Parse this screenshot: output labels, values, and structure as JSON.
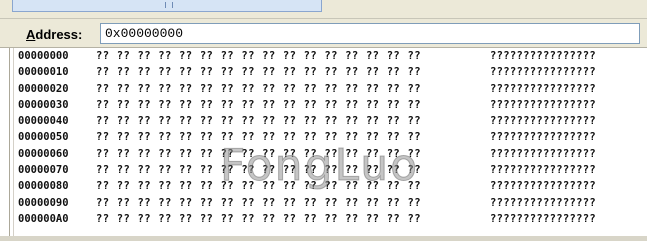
{
  "address_bar": {
    "label_first": "A",
    "label_rest": "ddress:",
    "value": "0x00000000"
  },
  "memory": {
    "rows": [
      {
        "addr": "00000000",
        "bytes": "?? ?? ?? ?? ?? ?? ?? ?? ?? ?? ?? ?? ?? ?? ?? ??",
        "ascii": "????????????????"
      },
      {
        "addr": "00000010",
        "bytes": "?? ?? ?? ?? ?? ?? ?? ?? ?? ?? ?? ?? ?? ?? ?? ??",
        "ascii": "????????????????"
      },
      {
        "addr": "00000020",
        "bytes": "?? ?? ?? ?? ?? ?? ?? ?? ?? ?? ?? ?? ?? ?? ?? ??",
        "ascii": "????????????????"
      },
      {
        "addr": "00000030",
        "bytes": "?? ?? ?? ?? ?? ?? ?? ?? ?? ?? ?? ?? ?? ?? ?? ??",
        "ascii": "????????????????"
      },
      {
        "addr": "00000040",
        "bytes": "?? ?? ?? ?? ?? ?? ?? ?? ?? ?? ?? ?? ?? ?? ?? ??",
        "ascii": "????????????????"
      },
      {
        "addr": "00000050",
        "bytes": "?? ?? ?? ?? ?? ?? ?? ?? ?? ?? ?? ?? ?? ?? ?? ??",
        "ascii": "????????????????"
      },
      {
        "addr": "00000060",
        "bytes": "?? ?? ?? ?? ?? ?? ?? ?? ?? ?? ?? ?? ?? ?? ?? ??",
        "ascii": "????????????????"
      },
      {
        "addr": "00000070",
        "bytes": "?? ?? ?? ?? ?? ?? ?? ?? ?? ?? ?? ?? ?? ?? ?? ??",
        "ascii": "????????????????"
      },
      {
        "addr": "00000080",
        "bytes": "?? ?? ?? ?? ?? ?? ?? ?? ?? ?? ?? ?? ?? ?? ?? ??",
        "ascii": "????????????????"
      },
      {
        "addr": "00000090",
        "bytes": "?? ?? ?? ?? ?? ?? ?? ?? ?? ?? ?? ?? ?? ?? ?? ??",
        "ascii": "????????????????"
      },
      {
        "addr": "000000A0",
        "bytes": "?? ?? ?? ?? ?? ?? ?? ?? ?? ?? ?? ?? ?? ?? ?? ??",
        "ascii": "????????????????"
      }
    ]
  },
  "watermark": "FongLuo"
}
